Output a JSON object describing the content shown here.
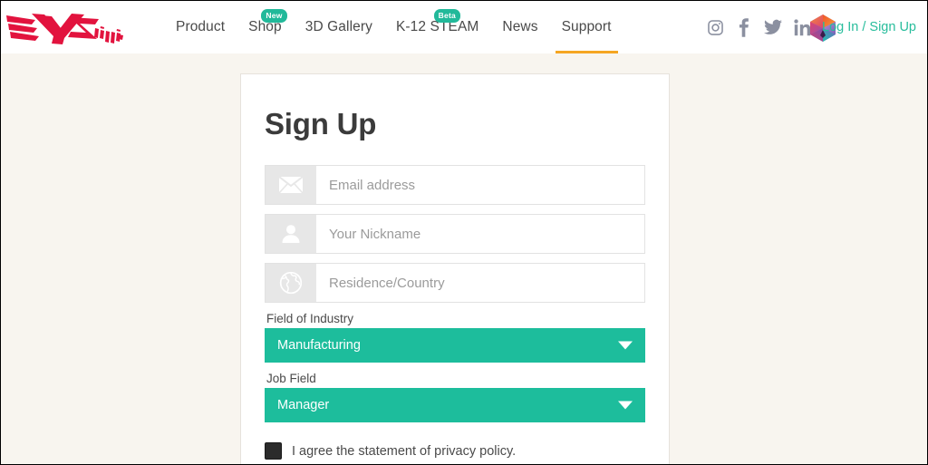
{
  "header": {
    "logo_alt": "XYZprinting",
    "logo_color": "#e2133e",
    "nav": [
      {
        "label": "Product",
        "badge": null,
        "active": false
      },
      {
        "label": "Shop",
        "badge": "New",
        "active": false
      },
      {
        "label": "3D Gallery",
        "badge": null,
        "active": false
      },
      {
        "label": "K-12 STEAM",
        "badge": "Beta",
        "active": false
      },
      {
        "label": "News",
        "badge": null,
        "active": false
      },
      {
        "label": "Support",
        "badge": null,
        "active": true
      }
    ],
    "social": [
      {
        "name": "instagram-icon"
      },
      {
        "name": "facebook-icon"
      },
      {
        "name": "twitter-icon"
      },
      {
        "name": "linkedin-icon"
      }
    ],
    "brand_gem_alt": "XYZmaker gem logo",
    "auth_label": "Log In / Sign Up",
    "auth_color": "#28bd9c",
    "active_underline_color": "#f5a623",
    "badge_color": "#22b99a"
  },
  "signup": {
    "title": "Sign Up",
    "fields": [
      {
        "icon": "envelope-icon",
        "placeholder": "Email address",
        "value": ""
      },
      {
        "icon": "person-icon",
        "placeholder": "Your Nickname",
        "value": ""
      },
      {
        "icon": "globe-icon",
        "placeholder": "Residence/Country",
        "value": ""
      }
    ],
    "selects": [
      {
        "label": "Field of Industry",
        "value": "Manufacturing"
      },
      {
        "label": "Job Field",
        "value": "Manager"
      }
    ],
    "agree_label": "I agree the statement of privacy policy.",
    "agree_checked": true,
    "select_color": "#1dbd9c"
  },
  "page": {
    "background_color": "#f8f5ef"
  }
}
